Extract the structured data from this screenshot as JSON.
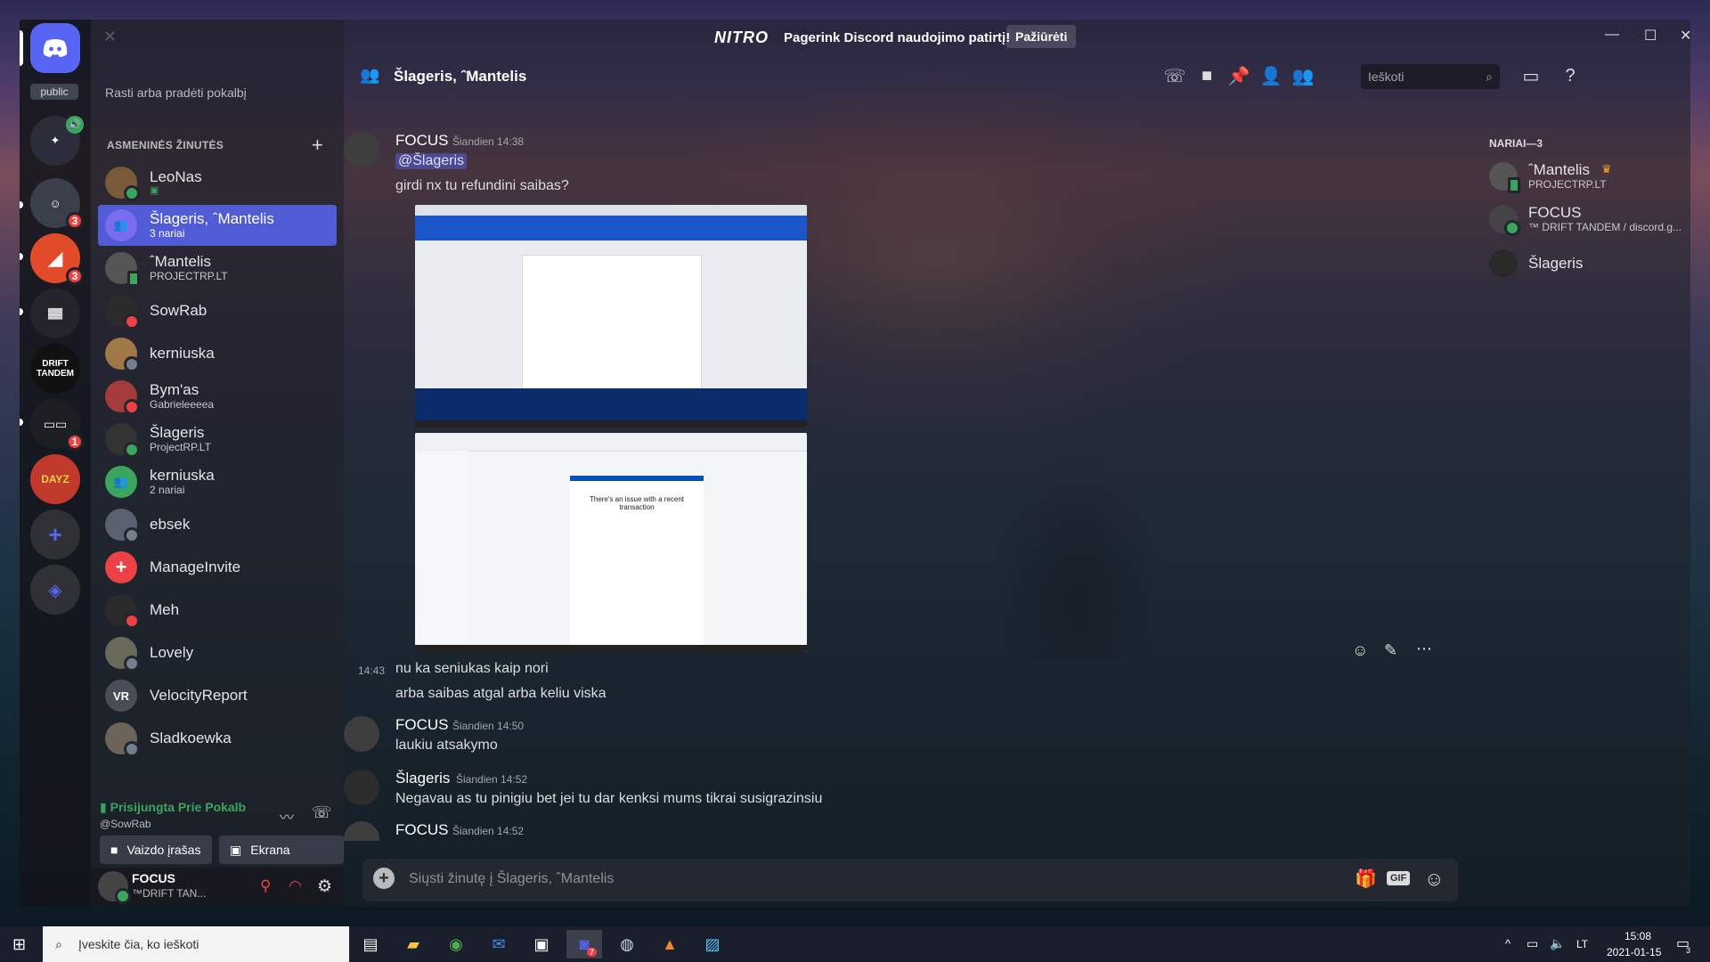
{
  "nitro_bar": {
    "logo": "NITRO",
    "text": "Pagerink Discord naudojimo patirtį!",
    "button": "Pažiūrėti"
  },
  "server_rail": {
    "public_label": "public",
    "servers": [
      {
        "name": "DRIFT TANDEM",
        "badge": ""
      },
      {
        "name": "DAYZ",
        "badge": ""
      }
    ],
    "badges": [
      "3",
      "3",
      "1"
    ]
  },
  "dm_sidebar": {
    "search_placeholder": "Rasti arba pradėti pokalbį",
    "section_title": "ASMENINĖS ŽINUTĖS",
    "items": [
      {
        "name": "LeoNas",
        "sub": ""
      },
      {
        "name": "Šlageris, ˆMantelis",
        "sub": "3 nariai"
      },
      {
        "name": "ˆMantelis",
        "sub": "PROJECTRP.LT"
      },
      {
        "name": "SowRab",
        "sub": ""
      },
      {
        "name": "kerniuska",
        "sub": ""
      },
      {
        "name": "Bym'as",
        "sub": "Gabrieleeeea"
      },
      {
        "name": "Šlageris",
        "sub": "ProjectRP.LT"
      },
      {
        "name": "kerniuska",
        "sub": "2 nariai"
      },
      {
        "name": "ebsek",
        "sub": ""
      },
      {
        "name": "ManageInvite",
        "sub": ""
      },
      {
        "name": "Meh",
        "sub": ""
      },
      {
        "name": "Lovely",
        "sub": ""
      },
      {
        "name": "VelocityReport",
        "sub": ""
      },
      {
        "name": "Sladkoewka",
        "sub": ""
      }
    ],
    "voice": {
      "status": "Prisijungta Prie Pokalb",
      "channel": "@SowRab",
      "video_button": "Vaizdo įrašas",
      "screen_button": "Ekrana"
    },
    "user": {
      "name": "FOCUS",
      "tag": "™DRIFT TAN..."
    }
  },
  "chat": {
    "title": "Šlageris, ˆMantelis",
    "search_placeholder": "Ieškoti",
    "messages": [
      {
        "author": "FOCUS",
        "time": "Šiandien 14:38",
        "mention": "@Šlageris",
        "text": "girdi nx tu refundini saibas?"
      },
      {
        "time_short": "14:43",
        "text": "nu ka seniukas kaip nori"
      },
      {
        "text": "arba saibas atgal arba keliu viska"
      },
      {
        "author": "FOCUS",
        "time": "Šiandien 14:50",
        "text": "laukiu atsakymo"
      },
      {
        "author": "Šlageris",
        "time": "Šiandien 14:52",
        "text": "Negavau as tu pinigiu bet jei tu dar kenksi mums tikrai susigrazinsiu"
      },
      {
        "author": "FOCUS",
        "time": "Šiandien 14:52",
        "text": ""
      }
    ],
    "screenshot2": {
      "heading": "There's an issue with a recent transaction"
    },
    "composer_placeholder": "Siųsti žinutę į Šlageris, ˆMantelis",
    "composer_gif": "GIF"
  },
  "members": {
    "title": "NARIAI—3",
    "list": [
      {
        "name": "ˆMantelis",
        "sub": "PROJECTRP.LT"
      },
      {
        "name": "FOCUS",
        "sub": "™ DRIFT TANDEM / discord.g..."
      },
      {
        "name": "Šlageris",
        "sub": ""
      }
    ]
  },
  "taskbar": {
    "search_placeholder": "Įveskite čia, ko ieškoti",
    "lang": "LT",
    "time": "15:08",
    "date": "2021-01-15",
    "notif_count": "3",
    "app_badge": "7"
  },
  "colors": {
    "blurple": "#5865f2",
    "online": "#3ba55d",
    "dnd": "#ed4245"
  }
}
